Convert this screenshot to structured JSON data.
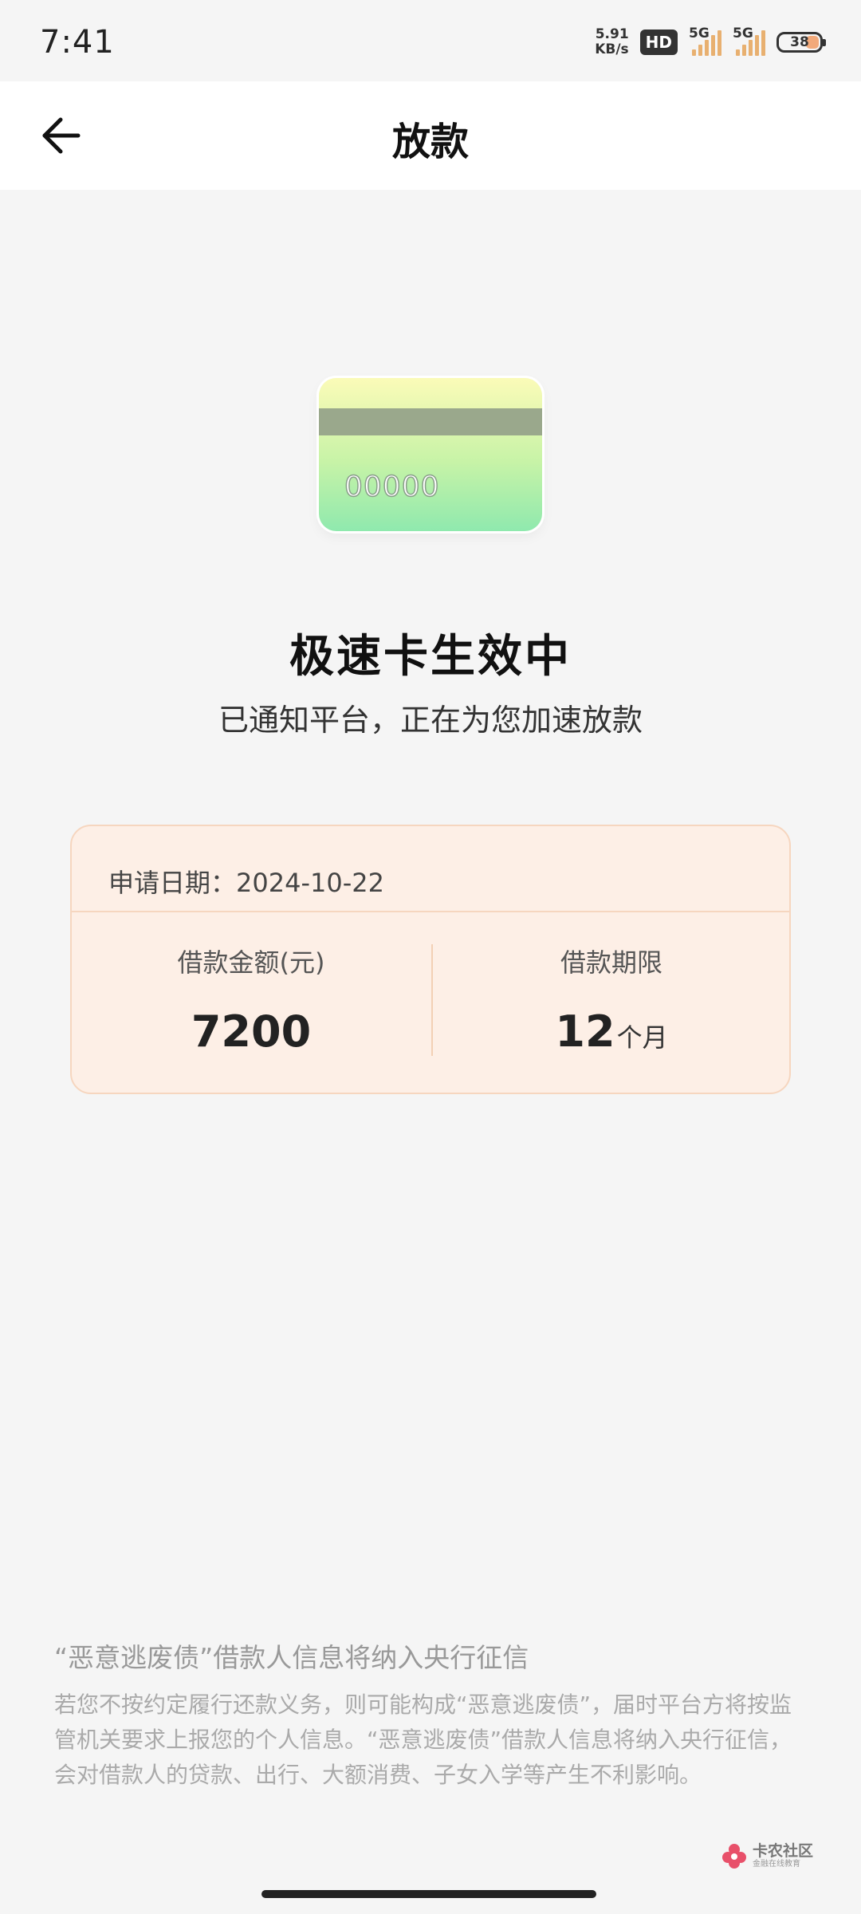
{
  "status_bar": {
    "time": "7:41",
    "net_speed_value": "5.91",
    "net_speed_unit": "KB/s",
    "hd_badge": "HD",
    "signal1_label": "5G",
    "signal2_label": "5G",
    "battery": "38"
  },
  "nav": {
    "title": "放款",
    "back_icon": "arrow-left-icon"
  },
  "card_illustration": {
    "number": "00000"
  },
  "status": {
    "headline": "极速卡生效中",
    "subline": "已通知平台，正在为您加速放款"
  },
  "loan": {
    "date_label": "申请日期：2024-10-22",
    "amount_label": "借款金额(元)",
    "amount_value": "7200",
    "term_label": "借款期限",
    "term_value": "12",
    "term_unit": "个月"
  },
  "notice": {
    "title": "“恶意逃废债”借款人信息将纳入央行征信",
    "body": "若您不按约定履行还款义务，则可能构成“恶意逃废债”，届时平台方将按监管机关要求上报您的个人信息。“恶意逃废债”借款人信息将纳入央行征信，会对借款人的贷款、出行、大额消费、子女入学等产生不利影响。"
  },
  "watermark": {
    "main": "卡农社区",
    "sub": "金融在线教育"
  },
  "colors": {
    "background": "#f5f5f5",
    "loan_card_bg": "#fdefe6",
    "loan_card_border": "#f6d6bf",
    "card_gradient_top": "#fbfbb8",
    "card_gradient_bottom": "#8fe9ae"
  }
}
